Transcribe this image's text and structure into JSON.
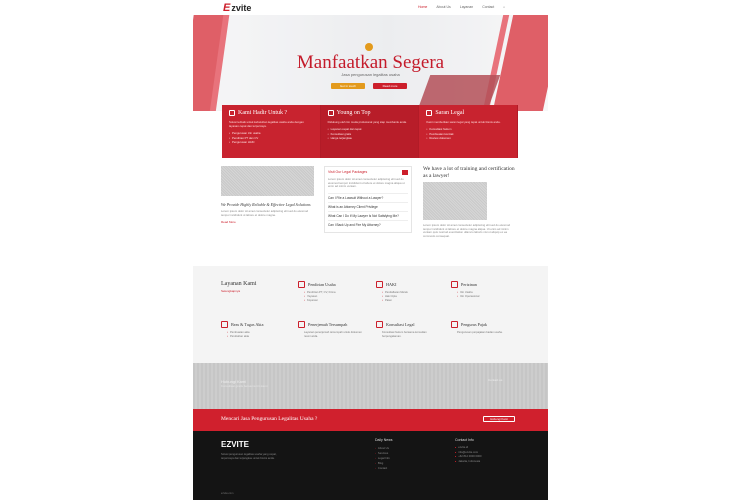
{
  "brand": {
    "logo_mark": "E",
    "logo_text": "zvite",
    "footer_logo": "EZVITE"
  },
  "nav": {
    "items": [
      "Home",
      "About Us",
      "Layanan",
      "Contact"
    ]
  },
  "hero": {
    "title": "Manfaatkan Segera",
    "subtitle": "Jasa pengurusan legalitas usaha",
    "btn_primary": "Get in touch",
    "btn_secondary": "Read more"
  },
  "features": [
    {
      "title": "Kami Hadir Untuk ?",
      "text": "Solusi terbaik untuk kebutuhan legalitas usaha anda dengan layanan cepat dan terpercaya.",
      "items": [
        "Pengurusan izin usaha",
        "Pendirian PT dan CV",
        "Pengurusan HAKI"
      ]
    },
    {
      "title": "Young on Top",
      "text": "Didukung oleh tim muda profesional yang siap membantu anda.",
      "items": [
        "Layanan cepat dan tepat",
        "Konsultasi gratis",
        "Harga terjangkau"
      ]
    },
    {
      "title": "Saran Legal",
      "text": "Kami memberikan saran legal yang tepat untuk bisnis anda.",
      "items": [
        "Konsultasi hukum",
        "Pembuatan kontrak",
        "Review dokumen"
      ]
    }
  ],
  "articles": {
    "col1_title": "We Provide Highly Reliable & Effective Legal Solutions",
    "col1_text": "Lorem ipsum dolor sit amet consectetur adipiscing elit sed do eiusmod tempor incididunt ut labore et dolore magna.",
    "col1_more": "Read More",
    "faq_header": "Visit Our Legal Packages",
    "faq_intro": "Lorem ipsum dolor sit amet consectetur adipiscing elit sed do eiusmod tempor incididunt ut labore et dolore magna aliqua ut enim ad minim veniam.",
    "faqs": [
      "Can I File a Lawsuit Without a Lawyer?",
      "What is an Attorney Client Privilege",
      "What Can I Do If My Lawyer Is Not Satisfying Me?",
      "Can I Back Up and Fire My Attorney?"
    ],
    "col3_title": "We have a lot of training and certification as a lawyer!",
    "col3_text": "Lorem ipsum dolor sit amet consectetur adipiscing elit sed do eiusmod tempor incididunt ut labore et dolore magna aliqua. Ut enim ad minim veniam quis nostrud exercitation ullamco laboris nisi ut aliquip ex ea commodo consequat."
  },
  "services": {
    "title": "Layanan Kami",
    "subtitle": "Selengkapnya",
    "items": [
      {
        "title": "Pendirian Usaha",
        "points": [
          "Pendirian PT, CV, Firma",
          "Yayasan",
          "Koperasi"
        ]
      },
      {
        "title": "HAKI",
        "points": [
          "Pendaftaran Merek",
          "Hak Cipta",
          "Paten"
        ]
      },
      {
        "title": "Perizinan",
        "points": [
          "Izin Usaha",
          "Izin Operasional"
        ]
      },
      {
        "title": "Beas & Tugas Akta",
        "points": [
          "Pembuatan akta",
          "Perubahan akta"
        ]
      },
      {
        "title": "Penerjemah Tersumpah",
        "text": "Layanan penerjemah tersumpah untuk dokumen resmi anda."
      },
      {
        "title": "Konsultasi Legal",
        "text": "Konsultasi hukum bersama konsultan berpengalaman."
      },
      {
        "title": "Pengurus Pajak",
        "text": "Pengurusan perpajakan badan usaha."
      }
    ]
  },
  "band": {
    "title": "Hubungi Kami",
    "subtitle": "Konsultasi gratis bersama tim kami",
    "right": "Contact us"
  },
  "cta": {
    "title": "Mencari Jasa Pengurusan Legalitas Usaha ?",
    "button": "Hubungi Kami"
  },
  "footer": {
    "desc": "Solusi pengurusan legalitas usaha yang cepat, terpercaya dan terjangkau untuk bisnis anda.",
    "copyright": "ezvite.com",
    "links_title": "Daily News",
    "links": [
      "About Us",
      "Services",
      "Legal Info",
      "Blog",
      "Contact"
    ],
    "contact_title": "Contact Info",
    "contact": [
      "ezvite.id",
      "info@ezvite.com",
      "+62 812 0000 0000",
      "Jakarta, Indonesia"
    ]
  },
  "colors": {
    "primary": "#cc1f2b",
    "accent": "#e39a1c",
    "footer": "#141414"
  }
}
